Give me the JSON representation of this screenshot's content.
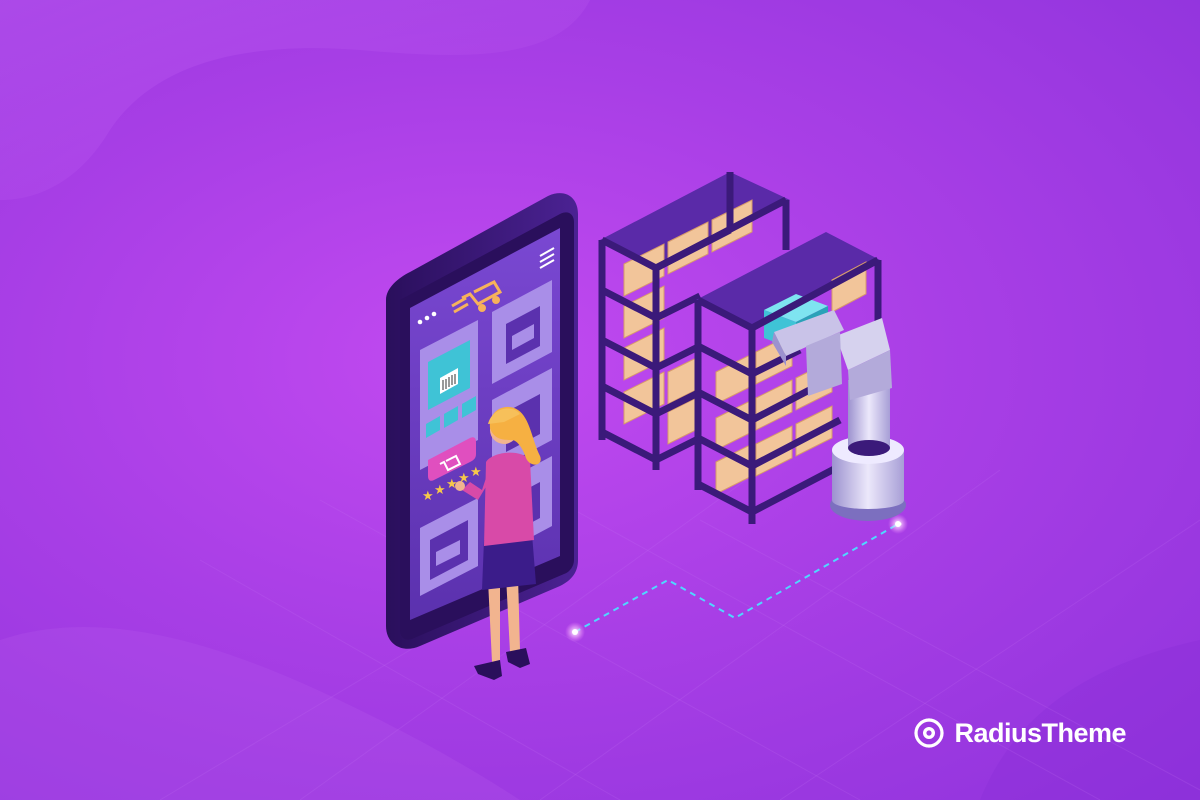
{
  "brand": {
    "name": "RadiusTheme",
    "logo_icon": "radius-swirl-icon"
  },
  "colors": {
    "background": "#a93fe6",
    "phone_body": "#3d1a7a",
    "phone_screen": "#6d3fc4",
    "shelf_frame": "#4b2293",
    "box": "#f2c59a",
    "robot": "#d6d2ee",
    "accent_teal": "#3fc3d6"
  },
  "illustration": {
    "rating_stars": 5
  }
}
